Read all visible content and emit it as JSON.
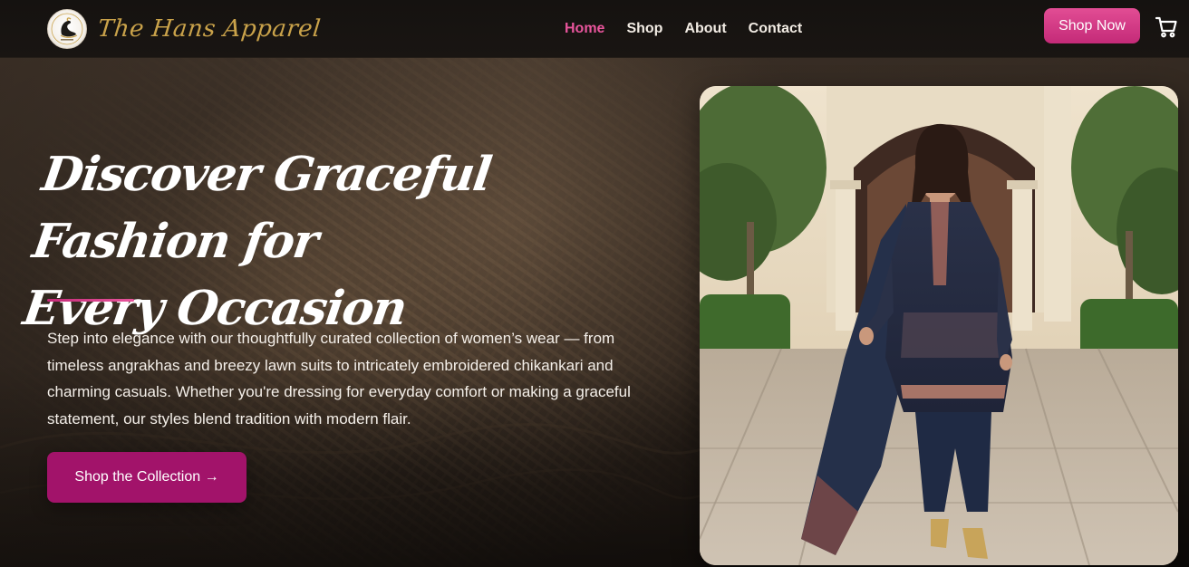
{
  "brand": {
    "name": "The Hans Apparel",
    "logo_icon": "swan-icon"
  },
  "nav": {
    "links": [
      {
        "label": "Home",
        "active": true
      },
      {
        "label": "Shop",
        "active": false
      },
      {
        "label": "About",
        "active": false
      },
      {
        "label": "Contact",
        "active": false
      }
    ],
    "shop_now_label": "Shop Now",
    "cart_icon": "cart-icon"
  },
  "hero": {
    "headline_line1": "Discover Graceful Fashion for",
    "headline_line2": "Every Occasion",
    "description": "Step into elegance with our thoughtfully curated collection of women’s wear — from timeless angrakhas and breezy lawn suits to intricately embroidered chikankari and charming casuals. Whether you're dressing for everyday comfort or making a graceful statement, our styles blend tradition with modern flair.",
    "cta_label": "Shop the Collection →"
  },
  "colors": {
    "accent_pink": "#e8559c",
    "button_pink": "#c42a78",
    "cta_magenta": "#a2136a",
    "brand_gold": "#c9a24a",
    "nav_bg": "#161310"
  }
}
